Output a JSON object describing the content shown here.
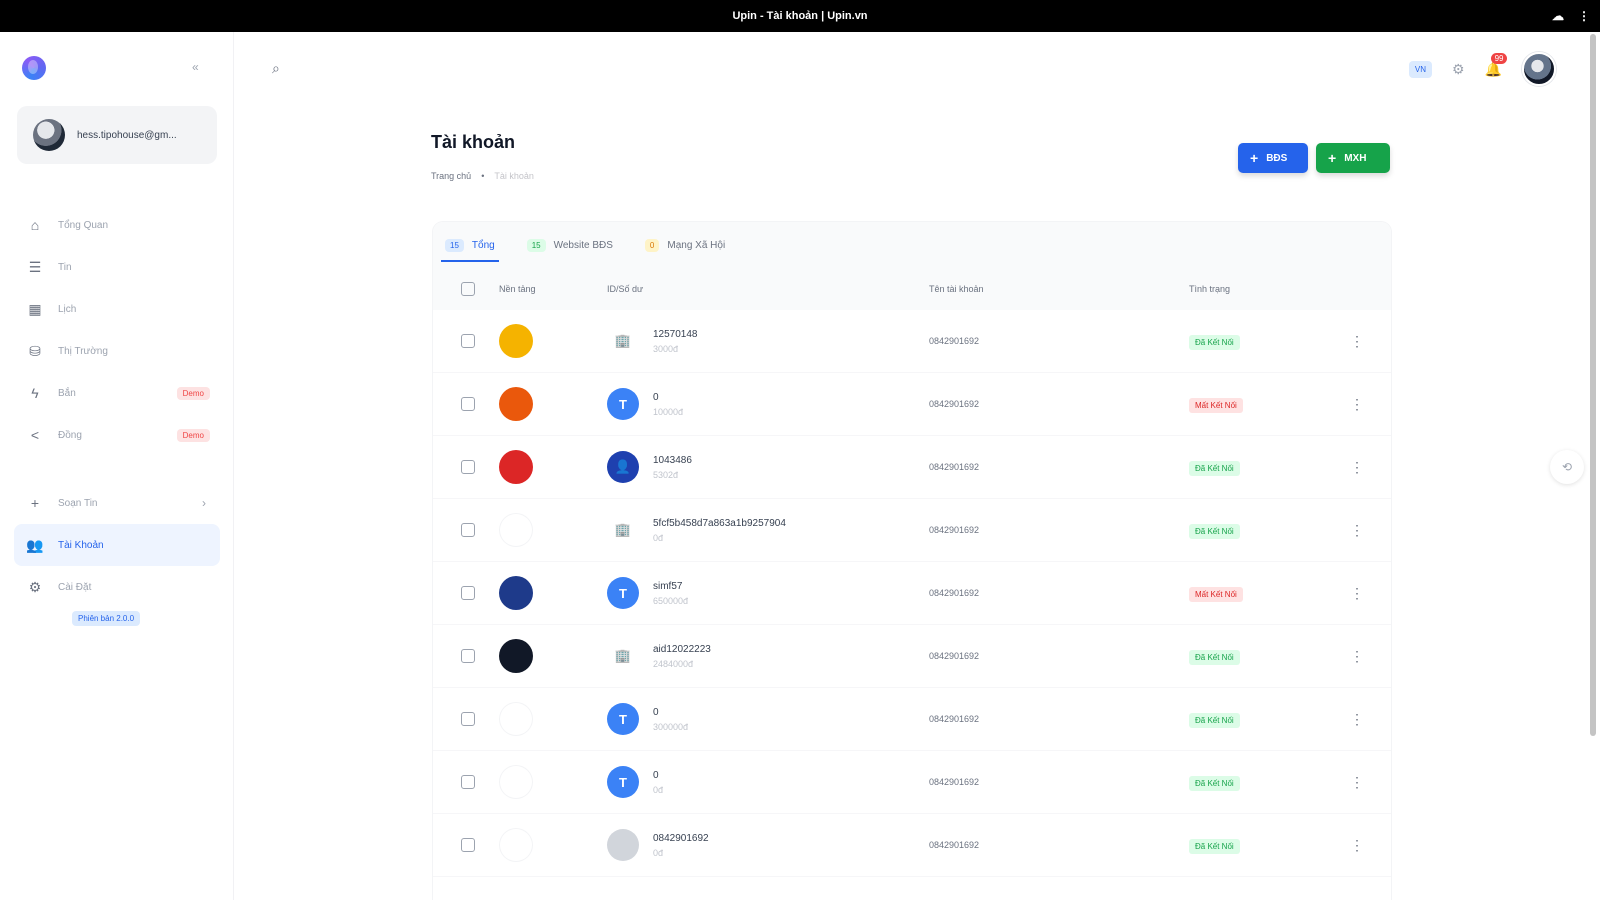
{
  "window": {
    "title": "Upin - Tài khoản | Upin.vn"
  },
  "sidebar": {
    "user": "hess.tipohouse@gm...",
    "items": [
      {
        "label": "Tổng Quan",
        "icon": "home-icon"
      },
      {
        "label": "Tin",
        "icon": "list-icon"
      },
      {
        "label": "Lịch",
        "icon": "calendar-icon"
      },
      {
        "label": "Thị Trường",
        "icon": "chart-icon"
      },
      {
        "label": "Bắn",
        "icon": "bolt-icon",
        "badge": "Demo"
      },
      {
        "label": "Đồng",
        "icon": "share-icon",
        "badge": "Demo"
      },
      {
        "label": "Soạn Tin",
        "icon": "plus-icon"
      },
      {
        "label": "Tài Khoản",
        "icon": "users-icon"
      },
      {
        "label": "Cài Đặt",
        "icon": "gear-icon"
      }
    ],
    "version": "Phiên bản 2.0.0"
  },
  "header": {
    "flag": "VN",
    "notification_count": "99"
  },
  "page": {
    "title": "Tài khoản",
    "breadcrumb": [
      "Trang chủ",
      "Tài khoản"
    ],
    "buttons": {
      "bds": "BĐS",
      "mxh": "MXH"
    }
  },
  "tabs": [
    {
      "count": "15",
      "label": "Tổng",
      "color": "#dbeafe",
      "fg": "#2563eb"
    },
    {
      "count": "15",
      "label": "Website BĐS",
      "color": "#dcfce7",
      "fg": "#16a34a"
    },
    {
      "count": "0",
      "label": "Mạng Xã Hội",
      "color": "#fef3c7",
      "fg": "#d97706"
    }
  ],
  "table": {
    "columns": [
      "Nền tảng",
      "ID/Số dư",
      "Tên tài khoản",
      "Tình trạng"
    ],
    "rows": [
      {
        "platform_color": "#f5b300",
        "platform_label": "",
        "id_type": "building",
        "id": "12570148",
        "balance": "3000đ",
        "account": "0842901692",
        "status": "Đã Kết Nối",
        "ok": true
      },
      {
        "platform_color": "#ea580c",
        "platform_label": "",
        "id_type": "T",
        "id": "0",
        "balance": "10000đ",
        "account": "0842901692",
        "status": "Mất Kết Nối",
        "ok": false
      },
      {
        "platform_color": "#dc2626",
        "platform_label": "",
        "id_type": "person",
        "id": "1043486",
        "balance": "5302đ",
        "account": "0842901692",
        "status": "Đã Kết Nối",
        "ok": true
      },
      {
        "platform_color": "#ffffff",
        "platform_label": "",
        "id_type": "building",
        "id": "5fcf5b458d7a863a1b9257904",
        "balance": "0đ",
        "account": "0842901692",
        "status": "Đã Kết Nối",
        "ok": true
      },
      {
        "platform_color": "#1e3a8a",
        "platform_label": "",
        "id_type": "T",
        "id": "simf57",
        "balance": "650000đ",
        "account": "0842901692",
        "status": "Mất Kết Nối",
        "ok": false
      },
      {
        "platform_color": "#111827",
        "platform_label": "",
        "id_type": "building",
        "id": "aid12022223",
        "balance": "2484000đ",
        "account": "0842901692",
        "status": "Đã Kết Nối",
        "ok": true
      },
      {
        "platform_color": "#ffffff",
        "platform_label": "",
        "id_type": "T",
        "id": "0",
        "balance": "300000đ",
        "account": "0842901692",
        "status": "Đã Kết Nối",
        "ok": true
      },
      {
        "platform_color": "#ffffff",
        "platform_label": "",
        "id_type": "T",
        "id": "0",
        "balance": "0đ",
        "account": "0842901692",
        "status": "Đã Kết Nối",
        "ok": true
      },
      {
        "platform_color": "#ffffff",
        "platform_label": "",
        "id_type": "gray",
        "id": "0842901692",
        "balance": "0đ",
        "account": "0842901692",
        "status": "Đã Kết Nối",
        "ok": true
      }
    ]
  }
}
